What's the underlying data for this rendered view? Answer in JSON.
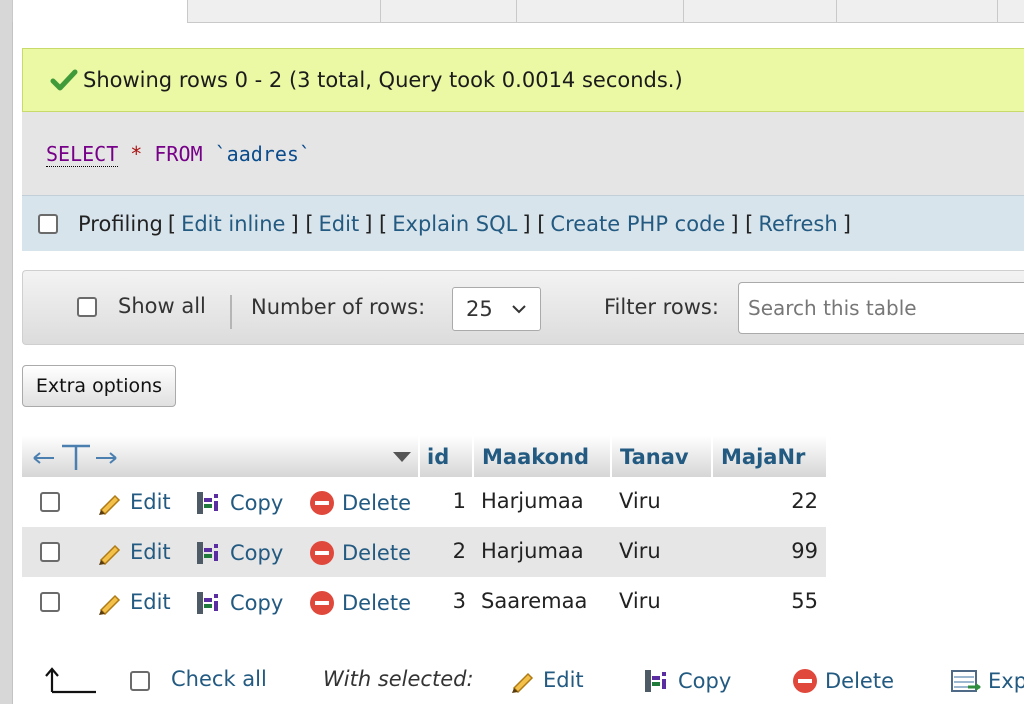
{
  "status": {
    "message": "Showing rows 0 - 2 (3 total, Query took 0.0014 seconds.)"
  },
  "query": {
    "select": "SELECT",
    "star": "*",
    "from": "FROM",
    "table": "`aadres`"
  },
  "query_links": {
    "profiling_label": "Profiling",
    "edit_inline": "Edit inline",
    "edit": "Edit",
    "explain_sql": "Explain SQL",
    "create_php": "Create PHP code",
    "refresh": "Refresh"
  },
  "navigation": {
    "show_all_label": "Show all",
    "rows_label": "Number of rows:",
    "rows_value": "25",
    "filter_label": "Filter rows:",
    "search_placeholder": "Search this table"
  },
  "extra_options_label": "Extra options",
  "table": {
    "columns": [
      "id",
      "Maakond",
      "Tanav",
      "MajaNr"
    ],
    "actions": {
      "edit": "Edit",
      "copy": "Copy",
      "delete": "Delete"
    },
    "rows": [
      {
        "id": "1",
        "Maakond": "Harjumaa",
        "Tanav": "Viru",
        "MajaNr": "22"
      },
      {
        "id": "2",
        "Maakond": "Harjumaa",
        "Tanav": "Viru",
        "MajaNr": "99"
      },
      {
        "id": "3",
        "Maakond": "Saaremaa",
        "Tanav": "Viru",
        "MajaNr": "55"
      }
    ]
  },
  "footer": {
    "check_all": "Check all",
    "with_selected": "With selected:",
    "edit": "Edit",
    "copy": "Copy",
    "delete": "Delete",
    "export": "Exp"
  },
  "colors": {
    "link": "#235a81",
    "success_bg": "#ebf8a4",
    "delete_icon": "#e0483b",
    "edit_icon": "#e8b43a"
  }
}
